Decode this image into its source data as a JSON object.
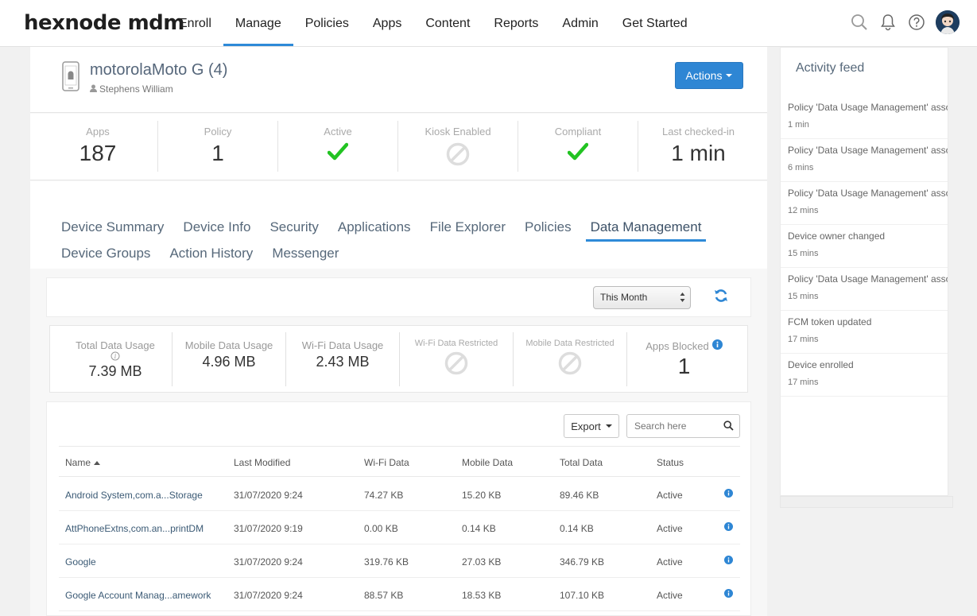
{
  "brand": {
    "logo": "hexnode mdm",
    "accent": "#2e8ad8"
  },
  "nav": {
    "items": [
      {
        "label": "Enroll",
        "active": false
      },
      {
        "label": "Manage",
        "active": true
      },
      {
        "label": "Policies",
        "active": false
      },
      {
        "label": "Apps",
        "active": false
      },
      {
        "label": "Content",
        "active": false
      },
      {
        "label": "Reports",
        "active": false
      },
      {
        "label": "Admin",
        "active": false
      },
      {
        "label": "Get Started",
        "active": false
      }
    ],
    "icons": [
      "search-icon",
      "bell-icon",
      "help-icon",
      "user-avatar"
    ]
  },
  "device": {
    "name": "motorolaMoto G (4)",
    "owner": "Stephens William",
    "actions_label": "Actions"
  },
  "stats": [
    {
      "label": "Apps",
      "value": "187"
    },
    {
      "label": "Policy",
      "value": "1"
    },
    {
      "label": "Active",
      "icon": "check-icon"
    },
    {
      "label": "Kiosk Enabled",
      "icon": "disabled-icon"
    },
    {
      "label": "Compliant",
      "icon": "check-icon"
    },
    {
      "label": "Last checked-in",
      "value": "1 min"
    }
  ],
  "tabs": {
    "row1": [
      "Device Summary",
      "Device Info",
      "Security",
      "Applications",
      "File Explorer",
      "Policies",
      "Data Management"
    ],
    "row2": [
      "Device Groups",
      "Action History",
      "Messenger"
    ],
    "active": "Data Management"
  },
  "filter": {
    "period": "This Month"
  },
  "usage": [
    {
      "label": "Total Data Usage",
      "value": "7.39 MB"
    },
    {
      "label": "Mobile Data Usage",
      "value": "4.96 MB"
    },
    {
      "label": "Wi-Fi Data Usage",
      "value": "2.43 MB"
    },
    {
      "label": "Wi-Fi Data Restricted",
      "icon": "disabled-icon"
    },
    {
      "label": "Mobile Data Restricted",
      "icon": "disabled-icon"
    },
    {
      "label": "Apps Blocked",
      "value": "1"
    }
  ],
  "table": {
    "export_label": "Export",
    "search_placeholder": "Search here",
    "columns": [
      "Name",
      "Last Modified",
      "Wi-Fi Data",
      "Mobile Data",
      "Total Data",
      "Status"
    ],
    "rows": [
      [
        "Android System,com.a...Storage",
        "31/07/2020 9:24",
        "74.27 KB",
        "15.20 KB",
        "89.46 KB",
        "Active"
      ],
      [
        "AttPhoneExtns,com.an...printDM",
        "31/07/2020 9:19",
        "0.00 KB",
        "0.14 KB",
        "0.14 KB",
        "Active"
      ],
      [
        "Google",
        "31/07/2020 9:24",
        "319.76 KB",
        "27.03 KB",
        "346.79 KB",
        "Active"
      ],
      [
        "Google Account Manag...amework",
        "31/07/2020 9:24",
        "88.57 KB",
        "18.53 KB",
        "107.10 KB",
        "Active"
      ]
    ]
  },
  "feed": {
    "title": "Activity feed",
    "items": [
      {
        "text": "Policy 'Data Usage Management' assoc",
        "time": "1 min"
      },
      {
        "text": "Policy 'Data Usage Management' assoc",
        "time": "6 mins"
      },
      {
        "text": "Policy 'Data Usage Management' assoc",
        "time": "12 mins"
      },
      {
        "text": "Device owner changed",
        "time": "15 mins"
      },
      {
        "text": "Policy 'Data Usage Management' assoc",
        "time": "15 mins"
      },
      {
        "text": "FCM token updated",
        "time": "17 mins"
      },
      {
        "text": "Device enrolled",
        "time": "17 mins"
      }
    ]
  }
}
